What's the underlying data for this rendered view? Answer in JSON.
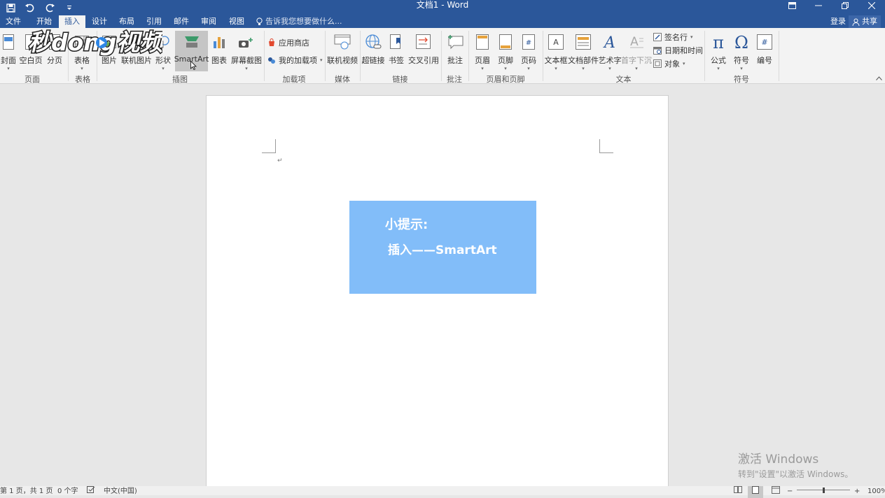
{
  "window": {
    "title": "文档1 - Word"
  },
  "tabs": [
    {
      "label": "文件"
    },
    {
      "label": "开始"
    },
    {
      "label": "插入"
    },
    {
      "label": "设计"
    },
    {
      "label": "布局"
    },
    {
      "label": "引用"
    },
    {
      "label": "邮件"
    },
    {
      "label": "审阅"
    },
    {
      "label": "视图"
    }
  ],
  "tell_me": {
    "placeholder": "告诉我您想要做什么..."
  },
  "account": {
    "login": "登录",
    "share": "共享"
  },
  "ribbon": {
    "pages": {
      "cover": "封面",
      "blank": "空白页",
      "break": "分页",
      "group": "页面"
    },
    "tables": {
      "table": "表格",
      "group": "表格"
    },
    "illustrations": {
      "picture": "图片",
      "online_picture": "联机图片",
      "shapes": "形状",
      "smartart": "SmartArt",
      "chart": "图表",
      "screenshot": "屏幕截图",
      "group": "插图"
    },
    "addins": {
      "store": "应用商店",
      "my_addins": "我的加载项",
      "group": "加载项"
    },
    "media": {
      "online_video": "联机视频",
      "group": "媒体"
    },
    "links": {
      "hyperlink": "超链接",
      "bookmark": "书签",
      "cross_ref": "交叉引用",
      "group": "链接"
    },
    "comments": {
      "comment": "批注",
      "group": "批注"
    },
    "header_footer": {
      "header": "页眉",
      "footer": "页脚",
      "page_number": "页码",
      "group": "页眉和页脚"
    },
    "text": {
      "textbox": "文本框",
      "quick_parts": "文档部件",
      "wordart": "艺术字",
      "dropcap": "首字下沉",
      "signature": "签名行",
      "datetime": "日期和时间",
      "object": "对象",
      "group": "文本"
    },
    "symbols": {
      "equation": "公式",
      "symbol": "符号",
      "number": "编号",
      "group": "符号"
    }
  },
  "watermark_logo": "秒懂视频",
  "document": {
    "tip_title": "小提示:",
    "tip_body": "插入——SmartArt"
  },
  "activation": {
    "line1": "激活 Windows",
    "line2": "转到\"设置\"以激活 Windows。"
  },
  "status": {
    "page": "第 1 页，共 1 页",
    "words": "0 个字",
    "language": "中文(中国)",
    "zoom": "100%"
  },
  "colors": {
    "accent": "#2b579a",
    "tipbox": "#82bdf9"
  }
}
